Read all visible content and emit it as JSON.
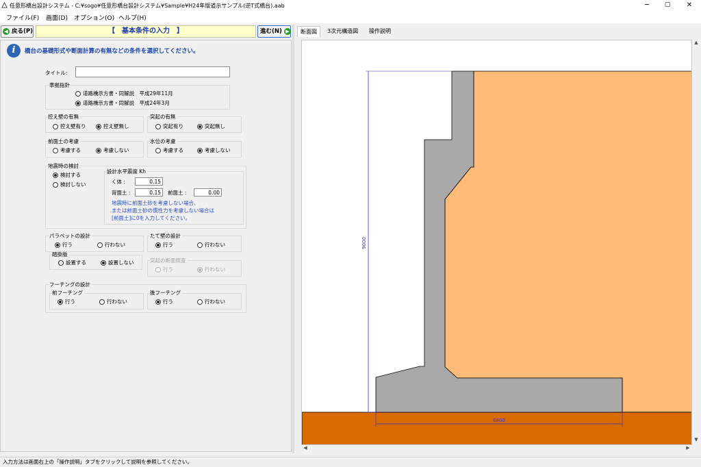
{
  "window": {
    "title": "任意形橋台設計システム - C:¥sogo¥任意形橋台設計システム¥Sample¥H24年版道示サンプル(逆T式橋台).aab",
    "minimize": "─",
    "maximize": "▢",
    "close": "✕"
  },
  "menu": [
    "ファイル(F)",
    "画面(D)",
    "オプション(O)",
    "ヘルプ(H)"
  ],
  "nav": {
    "back_label": "戻る(P)",
    "next_label": "進む(N)",
    "banner": "【　基本条件の入力　】"
  },
  "info_text": "橋台の基礎形式や断面計算の有無などの条件を選択してください。",
  "form": {
    "title_label": "タイトル:",
    "title_value": "",
    "standard": {
      "label": "準拠指針",
      "options": [
        "道路橋示方書・同解説　平成29年11月",
        "道路橋示方書・同解説　平成24年3月"
      ],
      "selected": 1
    },
    "counterfort": {
      "label": "控え壁の有無",
      "options": [
        "控え壁有り",
        "控え壁無し"
      ],
      "selected": 1
    },
    "protrusion": {
      "label": "突起の有無",
      "options": [
        "突起有り",
        "突起無し"
      ],
      "selected": 1
    },
    "front_soil": {
      "label": "前面土の考慮",
      "options": [
        "考慮する",
        "考慮しない"
      ],
      "selected": 1
    },
    "water_level": {
      "label": "水位の考慮",
      "options": [
        "考慮する",
        "考慮しない"
      ],
      "selected": 1
    },
    "seismic": {
      "label": "地震時の検討",
      "options": [
        "検討する",
        "検討しない"
      ],
      "selected": 0,
      "kh": {
        "label": "設計水平震度 Kh",
        "body_label": "く体 :",
        "body_value": "0.15",
        "back_label": "背面土 :",
        "back_value": "0.15",
        "front_label": "前面土 :",
        "front_value": "0.00"
      },
      "note": [
        "地震時に前面土砂を考慮しない場合、",
        "または前面土砂の慣性力を考慮しない場合は",
        "[前面土]に0を入力してください。"
      ]
    },
    "parapet": {
      "label": "パラペットの設計",
      "options": [
        "行う",
        "行わない"
      ],
      "selected": 0
    },
    "approach_slab": {
      "label": "踏掛版",
      "options": [
        "設置する",
        "設置しない"
      ],
      "selected": 1
    },
    "wall": {
      "label": "たて壁の設計",
      "options": [
        "行う",
        "行わない"
      ],
      "selected": 0
    },
    "protrusion_pos": {
      "label": "突起の断面照査",
      "options": [
        "行う",
        "行わない"
      ],
      "selected": 1
    },
    "footing": {
      "label": "フーチングの設計",
      "front": {
        "label": "前フーチング",
        "options": [
          "行う",
          "行わない"
        ],
        "selected": 0
      },
      "rear": {
        "label": "後フーチング",
        "options": [
          "行う",
          "行わない"
        ],
        "selected": 0
      }
    }
  },
  "tabs": [
    "断面図",
    "3次元構造図",
    "操作説明"
  ],
  "drawing": {
    "height_dim": "9000",
    "width_dim": "6800",
    "colors": {
      "soil": "#ffbb77",
      "ground": "#d86a00",
      "concrete": "#a9a9a9",
      "dim": "#3333cc"
    }
  },
  "status": "入力方法は画面右上の「操作説明」タブをクリックして説明を参照してください。"
}
